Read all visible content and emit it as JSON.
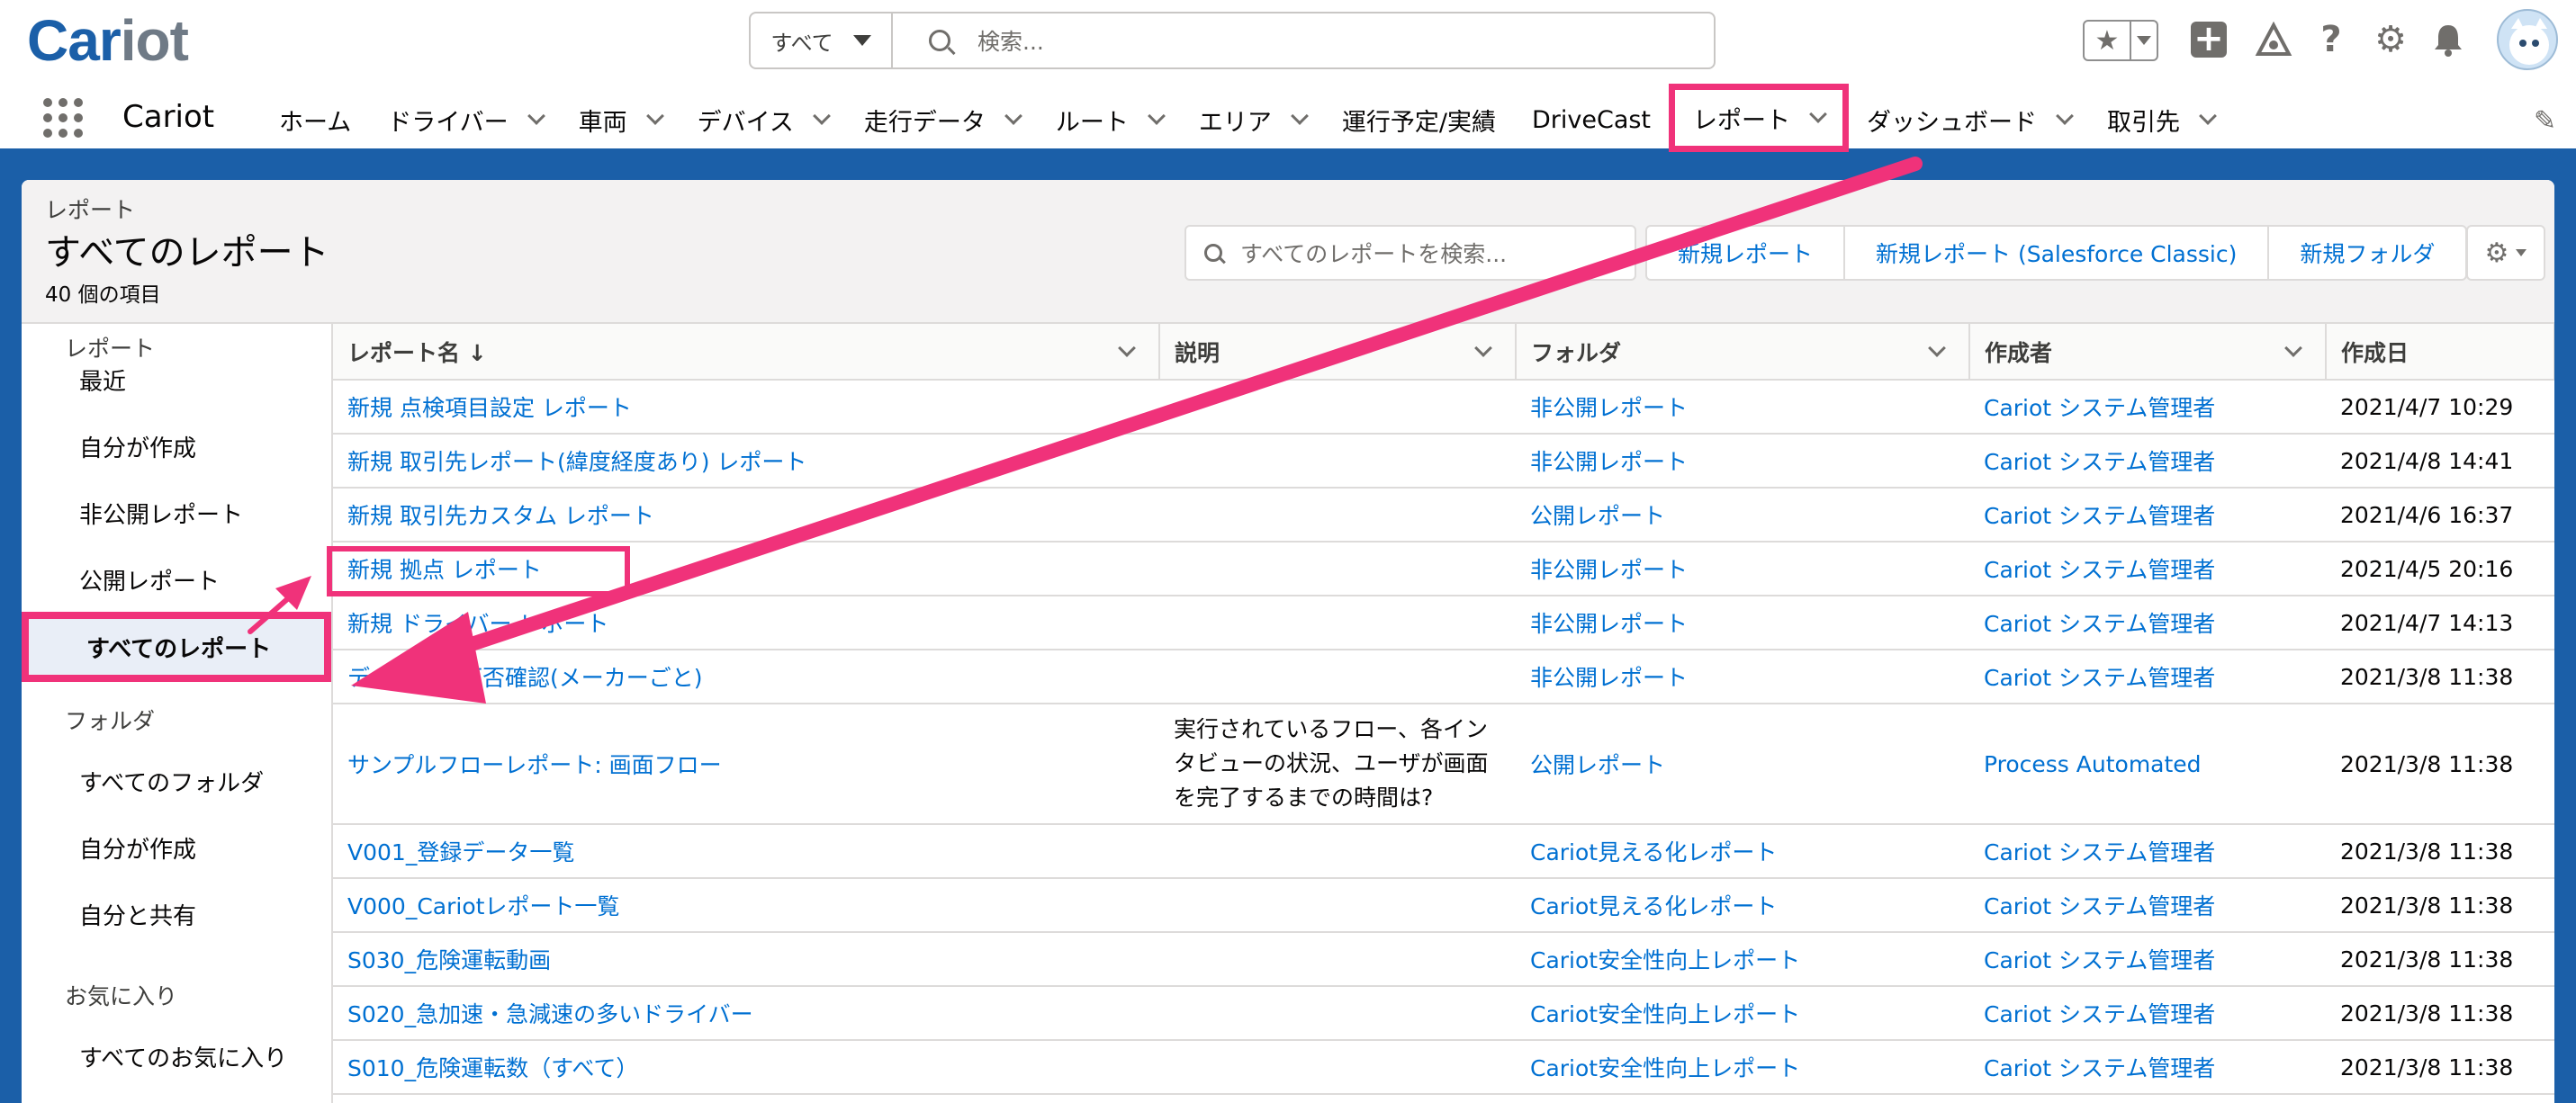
{
  "header": {
    "logo_main": "Car",
    "logo_accent": "iot",
    "search_scope": "すべて",
    "search_placeholder": "検索...",
    "icons": [
      "star-icon",
      "plus-icon",
      "trailhead-icon",
      "help-icon",
      "gear-icon",
      "bell-icon",
      "avatar"
    ]
  },
  "nav": {
    "app_name": "Cariot",
    "items": [
      {
        "label": "ホーム",
        "chevron": false
      },
      {
        "label": "ドライバー",
        "chevron": true
      },
      {
        "label": "車両",
        "chevron": true
      },
      {
        "label": "デバイス",
        "chevron": true
      },
      {
        "label": "走行データ",
        "chevron": true
      },
      {
        "label": "ルート",
        "chevron": true
      },
      {
        "label": "エリア",
        "chevron": true
      },
      {
        "label": "運行予定/実績",
        "chevron": false
      },
      {
        "label": "DriveCast",
        "chevron": false
      },
      {
        "label": "レポート",
        "chevron": true,
        "active": true
      },
      {
        "label": "ダッシュボード",
        "chevron": true
      },
      {
        "label": "取引先",
        "chevron": true
      }
    ]
  },
  "page_header": {
    "kicker": "レポート",
    "title": "すべてのレポート",
    "count": "40 個の項目",
    "search_placeholder": "すべてのレポートを検索...",
    "buttons": [
      "新規レポート",
      "新規レポート (Salesforce Classic)",
      "新規フォルダ"
    ]
  },
  "sidebar": {
    "sections": [
      {
        "label": "レポート",
        "items": [
          "最近",
          "自分が作成",
          "非公開レポート",
          "公開レポート",
          "すべてのレポート"
        ]
      },
      {
        "label": "フォルダ",
        "items": [
          "すべてのフォルダ",
          "自分が作成",
          "自分と共有"
        ]
      },
      {
        "label": "お気に入り",
        "items": [
          "すべてのお気に入り"
        ]
      }
    ],
    "active_item": "すべてのレポート"
  },
  "table": {
    "columns": [
      "レポート名 ↓",
      "説明",
      "フォルダ",
      "作成者",
      "作成日"
    ],
    "rows": [
      {
        "name": "新規 点検項目設定 レポート",
        "desc": "",
        "folder": "非公開レポート",
        "owner": "Cariot システム管理者",
        "date": "2021/4/7 10:29"
      },
      {
        "name": "新規 取引先レポート(緯度経度あり) レポート",
        "desc": "",
        "folder": "非公開レポート",
        "owner": "Cariot システム管理者",
        "date": "2021/4/8 14:41"
      },
      {
        "name": "新規 取引先カスタム レポート",
        "desc": "",
        "folder": "公開レポート",
        "owner": "Cariot システム管理者",
        "date": "2021/4/6 16:37"
      },
      {
        "name": "新規 拠点 レポート",
        "desc": "",
        "folder": "非公開レポート",
        "owner": "Cariot システム管理者",
        "date": "2021/4/5 20:16"
      },
      {
        "name": "新規 ドライバー レポート",
        "desc": "",
        "folder": "非公開レポート",
        "owner": "Cariot システム管理者",
        "date": "2021/4/7 14:13"
      },
      {
        "name": "データ取得可否確認(メーカーごと)",
        "desc": "",
        "folder": "非公開レポート",
        "owner": "Cariot システム管理者",
        "date": "2021/3/8 11:38"
      },
      {
        "name": "サンプルフローレポート: 画面フロー",
        "desc": "実行されているフロー、各インタビューの状況、ユーザが画面を完了するまでの時間は?",
        "folder": "公開レポート",
        "owner": "Process Automated",
        "date": "2021/3/8 11:38"
      },
      {
        "name": "V001_登録データ一覧",
        "desc": "",
        "folder": "Cariot見える化レポート",
        "owner": "Cariot システム管理者",
        "date": "2021/3/8 11:38"
      },
      {
        "name": "V000_Cariotレポート一覧",
        "desc": "",
        "folder": "Cariot見える化レポート",
        "owner": "Cariot システム管理者",
        "date": "2021/3/8 11:38"
      },
      {
        "name": "S030_危険運転動画",
        "desc": "",
        "folder": "Cariot安全性向上レポート",
        "owner": "Cariot システム管理者",
        "date": "2021/3/8 11:38"
      },
      {
        "name": "S020_急加速・急減速の多いドライバー",
        "desc": "",
        "folder": "Cariot安全性向上レポート",
        "owner": "Cariot システム管理者",
        "date": "2021/3/8 11:38"
      },
      {
        "name": "S010_危険運転数（すべて）",
        "desc": "",
        "folder": "Cariot安全性向上レポート",
        "owner": "Cariot システム管理者",
        "date": "2021/3/8 11:38"
      }
    ]
  },
  "annotation_color": "#f0327a"
}
